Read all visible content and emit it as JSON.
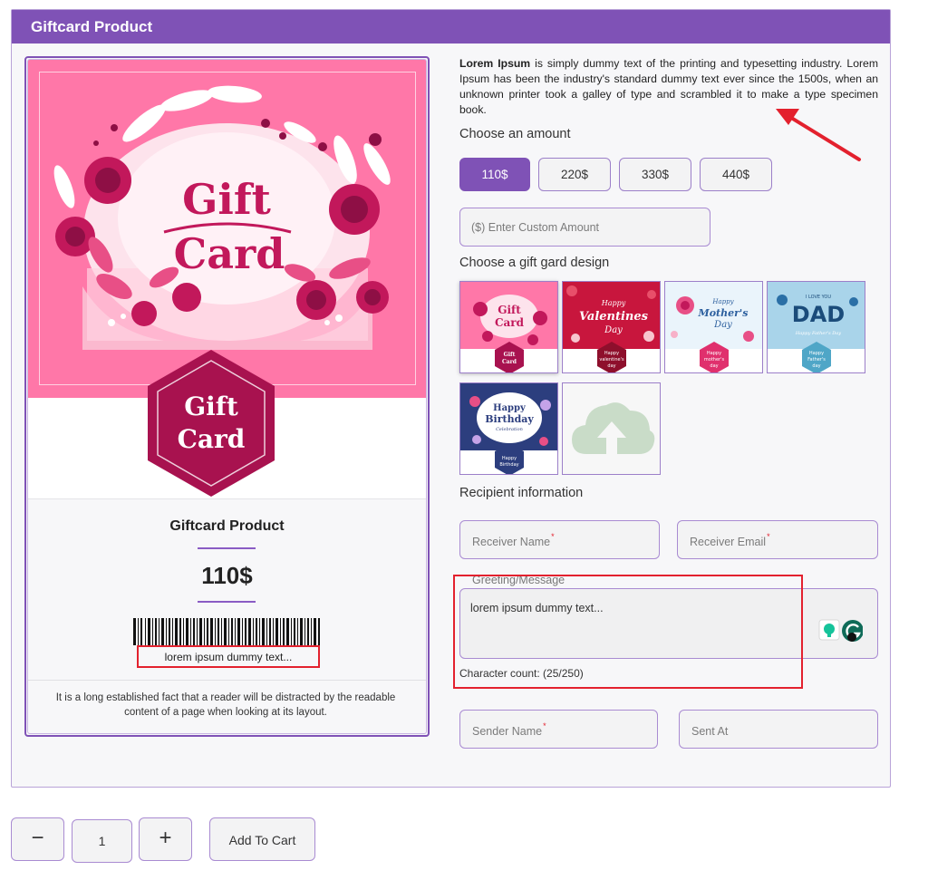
{
  "header": {
    "title": "Giftcard Product"
  },
  "card": {
    "hero_text_line1": "Gift",
    "hero_text_line2": "Card",
    "hex_text_line1": "Gift",
    "hex_text_line2": "Card",
    "title": "Giftcard Product",
    "price": "110$",
    "message": "lorem ipsum dummy text...",
    "description": "It is a long established fact that a reader will be distracted by the readable content of a page when looking at its layout."
  },
  "intro": {
    "bold": "Lorem Ipsum",
    "text": " is simply dummy text of the printing and typesetting industry. Lorem Ipsum has been the industry's standard dummy text ever since the 1500s, when an unknown printer took a galley of type and scrambled it to make a type specimen book."
  },
  "amount": {
    "label": "Choose an amount",
    "options": [
      "110$",
      "220$",
      "330$",
      "440$"
    ],
    "selected": "110$",
    "custom_placeholder": "($) Enter Custom Amount"
  },
  "design": {
    "label": "Choose a gift gard design",
    "thumbs": [
      {
        "line1": "Gift",
        "line2": "Card",
        "hex1": "Gift",
        "hex2": "Card"
      },
      {
        "line1": "Happy",
        "line2": "Valentines",
        "line3": "Day",
        "hex1": "Happy",
        "hex2": "valentine's",
        "hex3": "day"
      },
      {
        "line1": "Happy",
        "line2": "Mother's",
        "line3": "Day",
        "hex1": "Happy",
        "hex2": "mother's",
        "hex3": "day"
      },
      {
        "line1": "I LOVE YOU",
        "line2": "DAD",
        "line3": "Happy Father's Day",
        "hex1": "Happy",
        "hex2": "Father's",
        "hex3": "day"
      },
      {
        "line1": "Happy",
        "line2": "Birthday",
        "line3": "Celebration",
        "hex1": "Happy",
        "hex2": "Birthday"
      }
    ],
    "upload_icon": "cloud-upload-icon"
  },
  "recipient": {
    "label": "Recipient information",
    "receiver_name": "Receiver Name",
    "receiver_email": "Receiver Email",
    "greeting_label": "Greeting/Message",
    "greeting_value": "lorem ipsum dummy text...",
    "char_count": "Character count: (25/250)",
    "sender_name": "Sender Name",
    "sent_at": "Sent At"
  },
  "cart": {
    "minus": "−",
    "quantity": "1",
    "plus": "+",
    "add_label": "Add To Cart"
  },
  "colors": {
    "accent": "#7f52b6",
    "pink": "#ff77a8",
    "magenta": "#b0185e",
    "annotation": "#e3212e"
  }
}
